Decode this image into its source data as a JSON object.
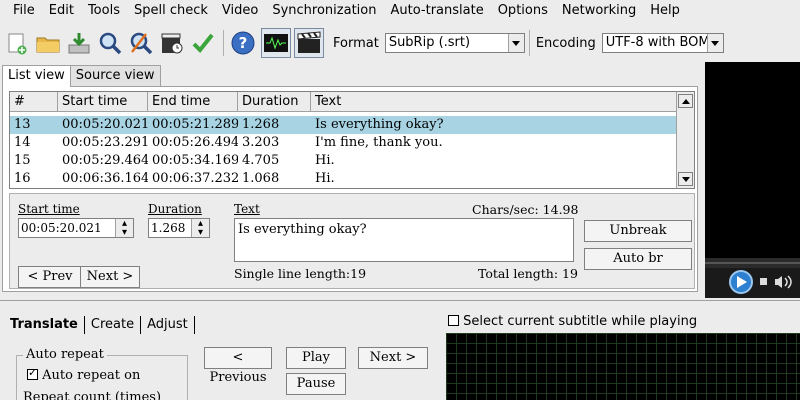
{
  "menu": [
    "File",
    "Edit",
    "Tools",
    "Spell check",
    "Video",
    "Synchronization",
    "Auto-translate",
    "Options",
    "Networking",
    "Help"
  ],
  "toolbar": {
    "format_label": "Format",
    "format_value": "SubRip (.srt)",
    "encoding_label": "Encoding",
    "encoding_value": "UTF-8 with BOM",
    "icons": [
      "new-file-icon",
      "open-folder-icon",
      "save-download-icon",
      "find-icon",
      "replace-icon",
      "visual-sync-icon",
      "spell-check-icon",
      "help-icon",
      "waveform-toggle-icon",
      "video-toggle-icon"
    ]
  },
  "tabs": [
    "List view",
    "Source view"
  ],
  "grid": {
    "headers": [
      "#",
      "Start time",
      "End time",
      "Duration",
      "Text"
    ],
    "rows": [
      {
        "num": "13",
        "start": "00:05:20.021",
        "end": "00:05:21.289",
        "duration": "1.268",
        "text": "Is everything okay?",
        "selected": true
      },
      {
        "num": "14",
        "start": "00:05:23.291",
        "end": "00:05:26.494",
        "duration": "3.203",
        "text": "I'm fine, thank you.",
        "selected": false
      },
      {
        "num": "15",
        "start": "00:05:29.464",
        "end": "00:05:34.169",
        "duration": "4.705",
        "text": "Hi.",
        "selected": false
      },
      {
        "num": "16",
        "start": "00:06:36.164",
        "end": "00:06:37.232",
        "duration": "1.068",
        "text": "Hi.",
        "selected": false
      }
    ]
  },
  "editor": {
    "start_label": "Start time",
    "start_value": "00:05:20.021",
    "duration_label": "Duration",
    "duration_value": "1.268",
    "text_label": "Text",
    "chars_sec": "Chars/sec: 14.98",
    "text_value": "Is everything okay?",
    "single_line": "Single line length:19",
    "total_length": "Total length: 19",
    "prev": "< Prev",
    "next": "Next >",
    "unbreak": "Unbreak",
    "auto_br": "Auto br"
  },
  "bottom": {
    "tabs": [
      "Translate",
      "Create",
      "Adjust"
    ],
    "select_current": "Select current subtitle while playing",
    "auto_repeat_legend": "Auto repeat",
    "auto_repeat_on": "Auto repeat on",
    "repeat_count": "Repeat count (times)",
    "previous": "< Previous",
    "play": "Play",
    "next": "Next >",
    "pause": "Pause"
  }
}
